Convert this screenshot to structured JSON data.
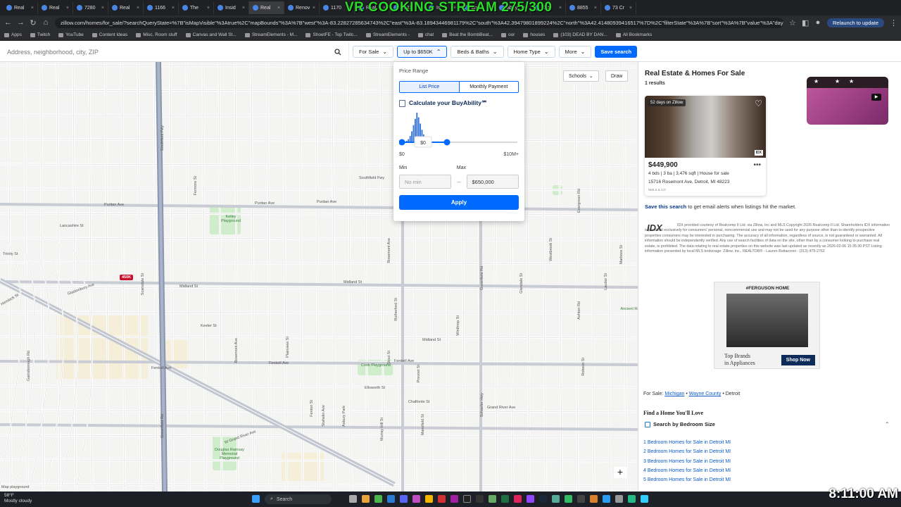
{
  "browser": {
    "tabs": [
      "Real",
      "Real",
      "7280",
      "Real",
      "1166",
      "The",
      "Insid",
      "Real",
      "Renov",
      "1170",
      "Real",
      "8121",
      "Is",
      "brm",
      "abey",
      "C of",
      "8855",
      "73 Cr"
    ],
    "url": "zillow.com/homes/for_sale/?searchQueryState=%7B\"isMapVisible\"%3Atrue%2C\"mapBounds\"%3A%7B\"west\"%3A-83.22827285634743%2C\"east\"%3A-83.18943446981179%2C\"south\"%3A42.39479801899224%2C\"north\"%3A42.41480939416517%7D%2C\"filterState\"%3A%7B\"sort\"%3A%7B\"value\"%3A\"days\"%7D%2...",
    "relaunch": "Relaunch to update",
    "bookmarks": [
      "Apps",
      "Twitch",
      "YouTube",
      "Content Ideas",
      "Misc. Room stuff",
      "Canvas and Wall St...",
      "StreamElements - M...",
      "ShoetFE - Top Twitc...",
      "StreamElements -",
      "chat",
      "Beat the BombBeat...",
      "oor",
      "houses",
      "(103) DEAD BY DAN...",
      "All Bookmarks"
    ]
  },
  "overlay": {
    "stream_title": "VR COOKING STREAM 275/300",
    "clock": "8:11:00 AM"
  },
  "filters": {
    "search_placeholder": "Address, neighborhood, city, ZIP",
    "for_sale": "For Sale",
    "price": "Up to $650K",
    "beds": "Beds & Baths",
    "home_type": "Home Type",
    "more": "More",
    "save": "Save search"
  },
  "map": {
    "schools": "Schools",
    "draw": "Draw",
    "pin": "450K",
    "streets": [
      "Puritan Ave",
      "Puritan Ave",
      "Puritan Ave",
      "Midland St",
      "Midland St",
      "Midland St",
      "Keeler St",
      "Fenkell Ave",
      "Fenkell Ave",
      "Fenkell Ave",
      "Ellsworth St",
      "Chalfonte St",
      "Grand River Ave",
      "W Grand River Ave",
      "Hemlock St",
      "Southfield Fwy",
      "Southfield Fwy",
      "Greenfield Rd",
      "Greenfield Rd",
      "Schaefer Hwy",
      "Evergreen Rd",
      "Ashton Rd",
      "Scarsdale St",
      "Lancashire St",
      "Glastonbury Ave",
      "Gainsborough Rd",
      "Trinity St",
      "Rutherford St",
      "Winthrop St",
      "Stout St",
      "Prevost St",
      "Marlowe St",
      "Robson St",
      "Lauder St",
      "Glendale St",
      "Rosemont Ave",
      "Fermore St",
      "Fenton St",
      "Plainview St",
      "Rosemont Ave",
      "Stahelin Ave",
      "Asbury Park",
      "Murray Hill St",
      "Mansfield St",
      "Westbrook St"
    ],
    "parks": [
      "Kelley Playground",
      "Cook Playground",
      "Douglas Ramsay Memorial Playground",
      "Ancient Ro"
    ],
    "copyright": "Map playground"
  },
  "price_popover": {
    "title": "Price Range",
    "tabs": [
      "List Price",
      "Monthly Payment"
    ],
    "buyability": "Calculate your BuyAbility℠",
    "slider_tooltip": "$0",
    "range_min_label": "$0",
    "range_max_label": "$10M+",
    "min_label": "Min",
    "max_label": "Max",
    "min_placeholder": "No min",
    "max_value": "$650,000",
    "apply": "Apply",
    "histogram": [
      2,
      4,
      8,
      14,
      22,
      30,
      38,
      32,
      24,
      16,
      10,
      6,
      4,
      2
    ]
  },
  "results": {
    "title": "Real Estate & Homes For Sale",
    "count": "1 results",
    "listing": {
      "badge": "52 days on Zillow",
      "price": "$449,900",
      "beds": "4",
      "baths": "3",
      "sqft": "3,476",
      "type": "House for sale",
      "facts": "4 bds | 3 ba | 3,476 sqft | House for sale",
      "address": "15716 Rosemont Ave, Detroit, MI 48223",
      "brokerage": "NMLS & CO"
    },
    "save_search_link": "Save this search",
    "save_search_rest": " to get email alerts when listings hit the market.",
    "idx": "IDX",
    "disclaimer": "IDX provided courtesy of Realcomp II Ltd. via Zillow, Inc and MLS Copyright 2026 Realcomp II Ltd. Shareholders IDX information is provided exclusively for consumers' personal, noncommercial use and may not be used for any purpose other than to identify prospective properties consumers may be interested in purchasing. The accuracy of all information, regardless of source, is not guaranteed or warranted. All information should be independently verified. Any use of search facilities of data on the site, other than by a consumer looking to purchase real estate, is prohibited. The data relating to real estate properties on this website was last updated as recently as 2026-02-06 15:35:30 PST Listing information presented by local MLS brokerage: Zillow, Inc., REALTOR® - Lauren Buttazzoni - (313) 479-2762",
    "ad": {
      "tag": "#FERGUSON HOME",
      "line1": "Top Brands",
      "line2": "in Appliances",
      "cta": "Shop Now"
    },
    "breadcrumb": {
      "prefix": "For Sale:",
      "state": "Michigan",
      "county": "Wayne County",
      "city": "Detroit"
    },
    "find_title": "Find a Home You'll Love",
    "bedroom_heading": "Search by Bedroom Size",
    "bedroom_links": [
      "1 Bedroom Homes for Sale in Detroit MI",
      "2 Bedroom Homes for Sale in Detroit MI",
      "3 Bedroom Homes for Sale in Detroit MI",
      "4 Bedroom Homes for Sale in Detroit MI",
      "5 Bedroom Homes for Sale in Detroit MI"
    ]
  },
  "taskbar": {
    "temp": "58°F",
    "weather": "Mostly cloudy",
    "search": "Search"
  }
}
